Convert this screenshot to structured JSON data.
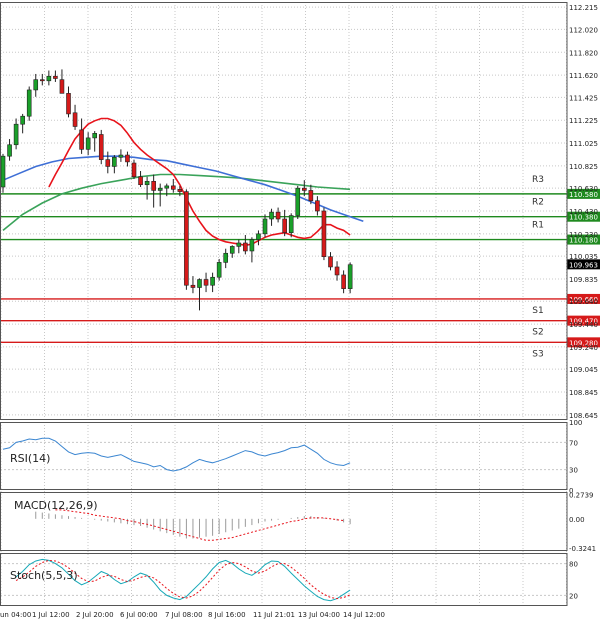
{
  "colors": {
    "background": "#ffffff",
    "grid": "#c8c8c8",
    "candle_up": "#1aa02a",
    "candle_down": "#d61a1a",
    "ma_red": "#e8131b",
    "ma_blue": "#3e6fd6",
    "ma_green": "#3aa35a",
    "resistance": "#1f8a1f",
    "support": "#d61a1a",
    "rsi": "#3b86d1",
    "macd_signal": "#e8131b",
    "macd_hist": "#9a9a9a",
    "stoch_main": "#17a9b8",
    "stoch_signal": "#e8131b",
    "current_price_box": "#000000"
  },
  "chart_data": [
    {
      "type": "candlestick",
      "title": "",
      "x_tick_labels": [
        "un 04:00",
        "1 Jul 12:00",
        "2 Jul 20:00",
        "6 Jul 00:00",
        "7 Jul 08:00",
        "8 Jul 16:00",
        "11 Jul 21:01",
        "13 Jul 04:00",
        "14 Jul 12:00"
      ],
      "y_tick_labels": [
        "112.215",
        "112.020",
        "111.820",
        "111.620",
        "111.425",
        "111.225",
        "111.025",
        "110.825",
        "110.630",
        "110.430",
        "110.230",
        "110.035",
        "109.835",
        "109.640",
        "109.440",
        "109.240",
        "109.045",
        "108.845",
        "108.645"
      ],
      "ylim": [
        108.6,
        112.26
      ],
      "current_price": "109.963",
      "levels": [
        {
          "name": "R3",
          "value": 110.58,
          "label": "110.580",
          "kind": "resistance"
        },
        {
          "name": "R2",
          "value": 110.38,
          "label": "110.380",
          "kind": "resistance"
        },
        {
          "name": "R1",
          "value": 110.18,
          "label": "110.180",
          "kind": "resistance"
        },
        {
          "name": "S1",
          "value": 109.66,
          "label": "109.660",
          "kind": "support"
        },
        {
          "name": "S2",
          "value": 109.47,
          "label": "109.470",
          "kind": "support"
        },
        {
          "name": "S3",
          "value": 109.28,
          "label": "109.280",
          "kind": "support"
        }
      ],
      "candles": [
        [
          110.64,
          110.93,
          110.59,
          110.91
        ],
        [
          110.91,
          111.06,
          110.87,
          111.01
        ],
        [
          111.01,
          111.24,
          110.97,
          111.19
        ],
        [
          111.19,
          111.28,
          111.11,
          111.26
        ],
        [
          111.26,
          111.52,
          111.22,
          111.49
        ],
        [
          111.49,
          111.63,
          111.43,
          111.58
        ],
        [
          111.58,
          111.63,
          111.53,
          111.57
        ],
        [
          111.57,
          111.66,
          111.53,
          111.61
        ],
        [
          111.61,
          111.66,
          111.56,
          111.59
        ],
        [
          111.58,
          111.67,
          111.5,
          111.46
        ],
        [
          111.46,
          111.52,
          111.25,
          111.28
        ],
        [
          111.29,
          111.36,
          111.14,
          111.17
        ],
        [
          111.14,
          111.24,
          110.93,
          110.97
        ],
        [
          110.97,
          111.12,
          110.92,
          111.07
        ],
        [
          111.07,
          111.13,
          110.95,
          111.11
        ],
        [
          111.1,
          111.14,
          110.84,
          110.88
        ],
        [
          110.88,
          110.95,
          110.76,
          110.82
        ],
        [
          110.82,
          110.92,
          110.76,
          110.9
        ],
        [
          110.9,
          110.97,
          110.86,
          110.92
        ],
        [
          110.92,
          110.95,
          110.82,
          110.86
        ],
        [
          110.85,
          110.88,
          110.71,
          110.73
        ],
        [
          110.73,
          110.78,
          110.64,
          110.66
        ],
        [
          110.66,
          110.73,
          110.53,
          110.69
        ],
        [
          110.69,
          110.75,
          110.46,
          110.61
        ],
        [
          110.61,
          110.67,
          110.47,
          110.63
        ],
        [
          110.63,
          110.67,
          110.56,
          110.65
        ],
        [
          110.65,
          110.71,
          110.59,
          110.62
        ],
        [
          110.62,
          110.65,
          110.56,
          110.6
        ],
        [
          110.6,
          110.62,
          109.74,
          109.78
        ],
        [
          109.78,
          109.86,
          109.71,
          109.76
        ],
        [
          109.76,
          109.84,
          109.56,
          109.83
        ],
        [
          109.83,
          109.89,
          109.72,
          109.78
        ],
        [
          109.78,
          109.89,
          109.72,
          109.85
        ],
        [
          109.85,
          110.01,
          109.82,
          109.98
        ],
        [
          109.98,
          110.1,
          109.93,
          110.06
        ],
        [
          110.06,
          110.13,
          110.02,
          110.12
        ],
        [
          110.12,
          110.18,
          110.06,
          110.15
        ],
        [
          110.15,
          110.22,
          110.05,
          110.08
        ],
        [
          110.08,
          110.2,
          109.98,
          110.18
        ],
        [
          110.18,
          110.26,
          110.13,
          110.23
        ],
        [
          110.23,
          110.4,
          110.2,
          110.36
        ],
        [
          110.36,
          110.45,
          110.3,
          110.42
        ],
        [
          110.42,
          110.46,
          110.33,
          110.36
        ],
        [
          110.36,
          110.44,
          110.21,
          110.24
        ],
        [
          110.24,
          110.41,
          110.2,
          110.39
        ],
        [
          110.39,
          110.65,
          110.36,
          110.63
        ],
        [
          110.63,
          110.7,
          110.56,
          110.61
        ],
        [
          110.61,
          110.66,
          110.49,
          110.52
        ],
        [
          110.52,
          110.56,
          110.39,
          110.43
        ],
        [
          110.43,
          110.46,
          110.0,
          110.03
        ],
        [
          110.03,
          110.07,
          109.91,
          109.94
        ],
        [
          109.94,
          109.99,
          109.82,
          109.87
        ],
        [
          109.87,
          109.91,
          109.71,
          109.75
        ],
        [
          109.75,
          109.98,
          109.71,
          109.96
        ]
      ],
      "ma_red": [
        110.64,
        110.75,
        110.85,
        110.96,
        111.06,
        111.13,
        111.19,
        111.22,
        111.24,
        111.24,
        111.22,
        111.18,
        111.11,
        111.03,
        110.97,
        110.92,
        110.88,
        110.84,
        110.8,
        110.75,
        110.66,
        110.54,
        110.43,
        110.34,
        110.26,
        110.21,
        110.18,
        110.16,
        110.15,
        110.14,
        110.13,
        110.14,
        110.17,
        110.2,
        110.22,
        110.23,
        110.24,
        110.22,
        110.2,
        110.19,
        110.2,
        110.25,
        110.31,
        110.31,
        110.28,
        110.26,
        110.22
      ],
      "ma_blue": [
        110.7,
        110.76,
        110.82,
        110.86,
        110.89,
        110.9,
        110.91,
        110.91,
        110.9,
        110.88,
        110.87,
        110.84,
        110.81,
        110.78,
        110.74,
        110.7,
        110.66,
        110.61,
        110.56,
        110.5,
        110.44,
        110.39,
        110.34
      ],
      "ma_green": [
        110.26,
        110.4,
        110.5,
        110.58,
        110.63,
        110.67,
        110.7,
        110.73,
        110.75,
        110.75,
        110.74,
        110.73,
        110.72,
        110.7,
        110.68,
        110.66,
        110.64,
        110.62
      ],
      "x_values": {
        "ma_red": [
          0,
          1,
          2,
          3,
          4,
          5,
          6,
          7,
          8,
          9,
          10,
          11,
          12,
          13,
          14,
          15,
          16,
          17,
          18,
          19,
          20,
          21,
          22,
          23,
          24,
          25,
          26,
          27,
          28,
          29,
          30,
          31,
          32,
          33,
          34,
          35,
          36,
          37,
          38,
          39,
          40,
          41,
          42,
          43,
          44,
          45,
          46
        ],
        "ma_blue": [
          0,
          2.5,
          5,
          7.5,
          10,
          12.5,
          15,
          17.5,
          20,
          22.5,
          25,
          27.5,
          30,
          32.5,
          35,
          37.5,
          40,
          42.5,
          45,
          47.5,
          50,
          52.5,
          55
        ],
        "ma_green": [
          0,
          3,
          6,
          9,
          12,
          15,
          18,
          21,
          24,
          27,
          30,
          33,
          36,
          39,
          42,
          45,
          48,
          53
        ]
      },
      "ma_red_offset_index": 7
    },
    {
      "type": "line",
      "name_label": "RSI(14)",
      "y_tick_labels": [
        "100",
        "70",
        "30",
        "0"
      ],
      "ylim": [
        0,
        100
      ],
      "values": [
        60,
        62,
        70,
        72,
        75,
        74,
        76,
        76,
        72,
        64,
        56,
        52,
        54,
        55,
        54,
        50,
        48,
        50,
        52,
        47,
        42,
        40,
        38,
        34,
        36,
        30,
        28,
        30,
        34,
        40,
        45,
        42,
        40,
        43,
        46,
        50,
        54,
        58,
        56,
        52,
        50,
        53,
        55,
        58,
        62,
        63,
        66,
        60,
        54,
        45,
        40,
        37,
        36,
        40
      ]
    },
    {
      "type": "bar",
      "name_label": "MACD(12,26,9)",
      "y_tick_labels": [
        "0.2739",
        "0.00",
        "-0.3241"
      ],
      "ylim": [
        -0.36,
        0.3
      ],
      "hist": [
        0.08,
        0.07,
        0.06,
        0.05,
        0.04,
        0.03,
        0.02,
        0.01,
        0.0,
        -0.01,
        -0.02,
        -0.03,
        -0.04,
        -0.05,
        -0.06,
        -0.07,
        -0.08,
        -0.1,
        -0.12,
        -0.14,
        -0.16,
        -0.18,
        -0.2,
        -0.22,
        -0.22,
        -0.21,
        -0.2,
        -0.19,
        -0.17,
        -0.15,
        -0.13,
        -0.11,
        -0.09,
        -0.07,
        -0.05,
        -0.03,
        -0.02,
        -0.01,
        0.0,
        0.01,
        0.02,
        0.03,
        0.03,
        0.02,
        0.01,
        0.0,
        -0.02,
        -0.04,
        -0.06
      ],
      "signal": [
        0.1,
        0.1,
        0.09,
        0.08,
        0.07,
        0.06,
        0.04,
        0.03,
        0.02,
        0.01,
        0.0,
        -0.02,
        -0.03,
        -0.05,
        -0.06,
        -0.08,
        -0.1,
        -0.12,
        -0.14,
        -0.16,
        -0.18,
        -0.2,
        -0.22,
        -0.24,
        -0.24,
        -0.23,
        -0.22,
        -0.21,
        -0.19,
        -0.17,
        -0.15,
        -0.13,
        -0.11,
        -0.09,
        -0.07,
        -0.05,
        -0.03,
        -0.02,
        0.0,
        0.01,
        0.01,
        0.01,
        0.0,
        -0.01,
        -0.02
      ]
    },
    {
      "type": "line",
      "name_label": "Stoch(5,5,3)",
      "y_tick_labels": [
        "80",
        "20"
      ],
      "ylim": [
        0,
        100
      ],
      "main": [
        55,
        65,
        78,
        85,
        88,
        86,
        80,
        72,
        60,
        48,
        40,
        45,
        55,
        65,
        60,
        50,
        42,
        46,
        55,
        62,
        58,
        45,
        30,
        20,
        15,
        12,
        18,
        30,
        42,
        55,
        70,
        82,
        86,
        80,
        70,
        62,
        58,
        66,
        78,
        85,
        84,
        75,
        62,
        50,
        38,
        28,
        18,
        12,
        10,
        14,
        22,
        30
      ],
      "signal": [
        48,
        55,
        64,
        75,
        82,
        86,
        85,
        80,
        72,
        62,
        52,
        46,
        47,
        54,
        58,
        56,
        50,
        46,
        49,
        54,
        57,
        53,
        44,
        33,
        24,
        17,
        15,
        19,
        28,
        40,
        54,
        68,
        78,
        82,
        80,
        74,
        66,
        62,
        66,
        74,
        80,
        80,
        73,
        63,
        52,
        40,
        30,
        22,
        16,
        14,
        16,
        21
      ]
    }
  ]
}
